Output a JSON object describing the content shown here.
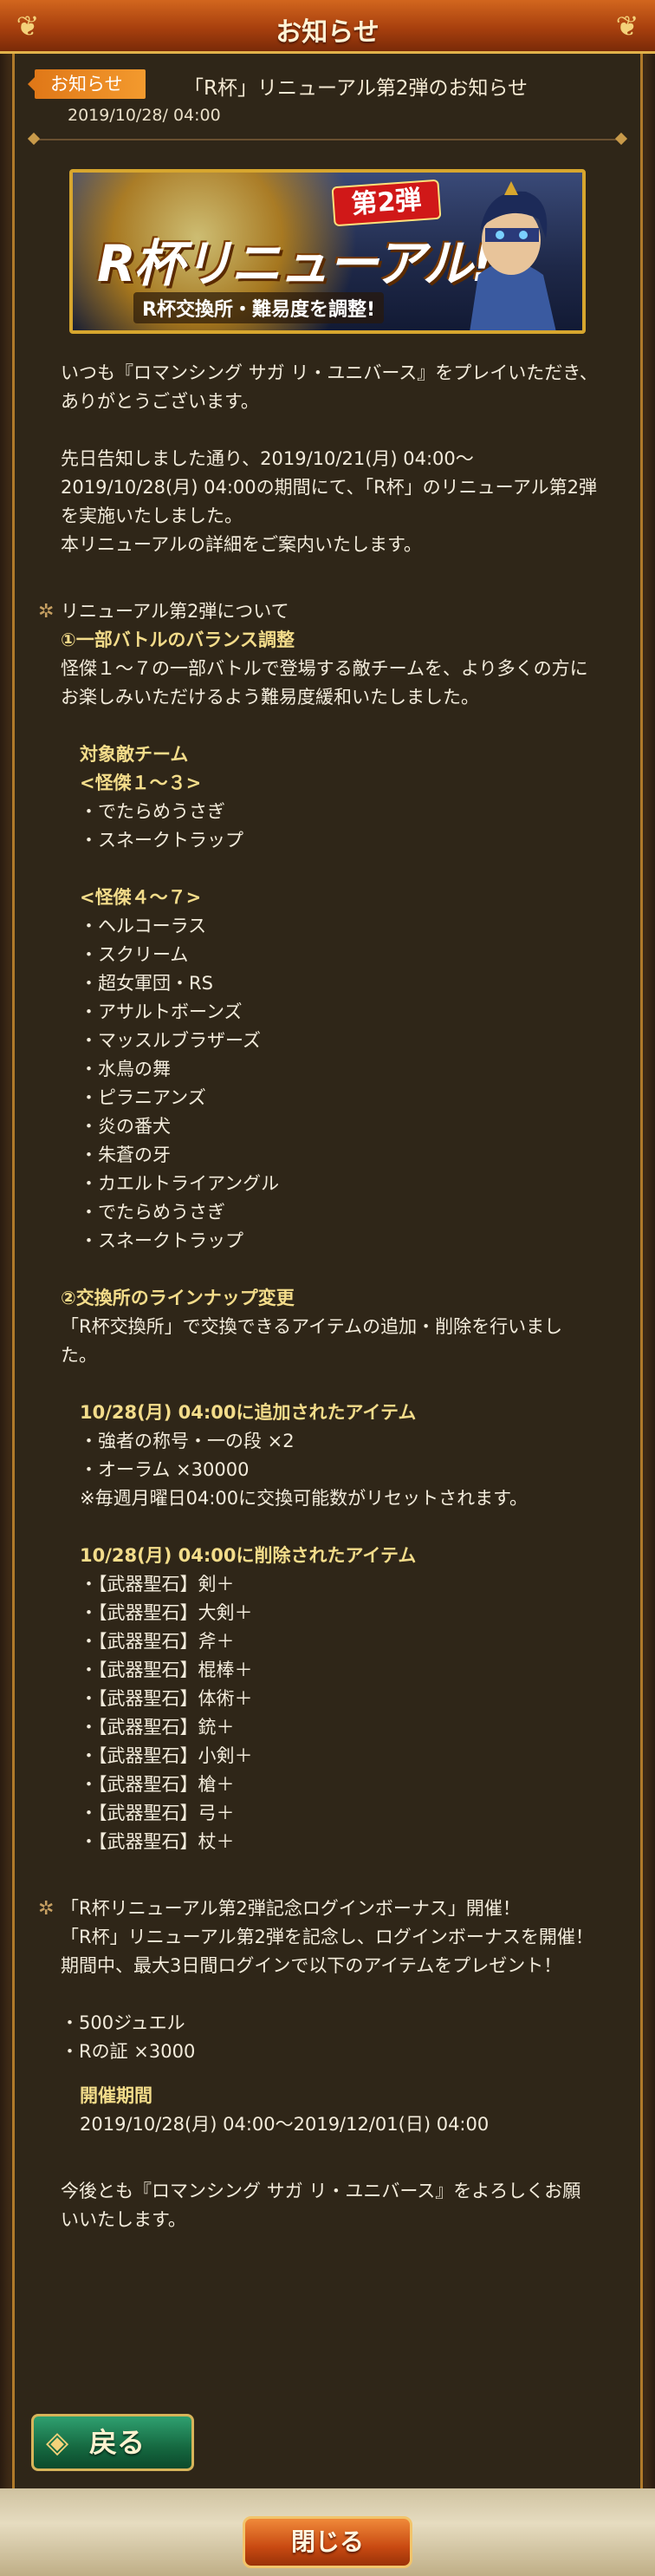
{
  "header": {
    "title": "お知らせ"
  },
  "notice": {
    "tag": "お知らせ",
    "title": "「R杯」リニューアル第2弾のお知らせ",
    "date": "2019/10/28/ 04:00"
  },
  "banner": {
    "badge": "第2弾",
    "main": "R杯リニューアル!",
    "sub": "R杯交換所・難易度を調整!"
  },
  "intro": [
    "いつも『ロマンシング サガ リ・ユニバース』をプレイいただき、ありがとうございます。",
    "先日告知しました通り、2019/10/21(月) 04:00～2019/10/28(月) 04:00の期間にて、「R杯」のリニューアル第2弾を実施いたしました。",
    "本リニューアルの詳細をご案内いたします。"
  ],
  "section1": {
    "title": "リニューアル第2弾について",
    "part1": {
      "heading": "①一部バトルのバランス調整",
      "body": "怪傑１～７の一部バトルで登場する敵チームを、より多くの方にお楽しみいただけるよう難易度緩和いたしました。",
      "target_label": "対象敵チーム",
      "group1_label": "<怪傑１～３>",
      "group1_items": [
        "・でたらめうさぎ",
        "・スネークトラップ"
      ],
      "group2_label": "<怪傑４～７>",
      "group2_items": [
        "・ヘルコーラス",
        "・スクリーム",
        "・超女軍団・RS",
        "・アサルトボーンズ",
        "・マッスルブラザーズ",
        "・水鳥の舞",
        "・ピラニアンズ",
        "・炎の番犬",
        "・朱蒼の牙",
        "・カエルトライアングル",
        "・でたらめうさぎ",
        "・スネークトラップ"
      ]
    },
    "part2": {
      "heading": "②交換所のラインナップ変更",
      "body": "「R杯交換所」で交換できるアイテムの追加・削除を行いました。",
      "added_label": "10/28(月) 04:00に追加されたアイテム",
      "added_items": [
        "・強者の称号・一の段 ×2",
        "・オーラム ×30000"
      ],
      "added_note": "※毎週月曜日04:00に交換可能数がリセットされます。",
      "removed_label": "10/28(月) 04:00に削除されたアイテム",
      "removed_items": [
        "・【武器聖石】剣＋",
        "・【武器聖石】大剣＋",
        "・【武器聖石】斧＋",
        "・【武器聖石】棍棒＋",
        "・【武器聖石】体術＋",
        "・【武器聖石】銃＋",
        "・【武器聖石】小剣＋",
        "・【武器聖石】槍＋",
        "・【武器聖石】弓＋",
        "・【武器聖石】杖＋"
      ]
    }
  },
  "section2": {
    "title": "「R杯リニューアル第2弾記念ログインボーナス」開催！",
    "body1": "「R杯」リニューアル第2弾を記念し、ログインボーナスを開催！",
    "body2": "期間中、最大3日間ログインで以下のアイテムをプレゼント！",
    "items": [
      "・500ジュエル",
      "・Rの証 ×3000"
    ],
    "period_label": "開催期間",
    "period": "2019/10/28(月) 04:00～2019/12/01(日) 04:00"
  },
  "closing": "今後とも『ロマンシング サガ リ・ユニバース』をよろしくお願いいたします。",
  "buttons": {
    "back": "戻る",
    "close": "閉じる"
  },
  "colors": {
    "accent": "#d2661e",
    "panel": "#2f2618",
    "heading": "#f3dc8a",
    "text": "#f3ecdc"
  }
}
